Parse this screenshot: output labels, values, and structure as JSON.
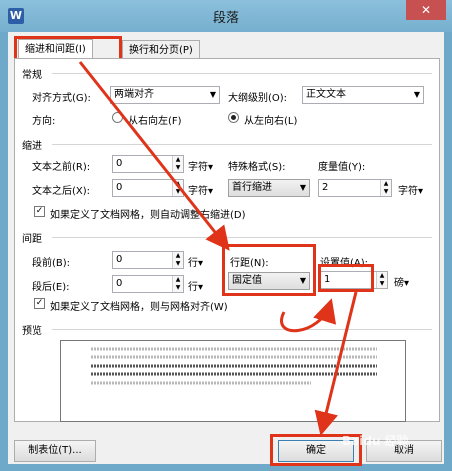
{
  "window": {
    "app_icon": "W",
    "title": "段落",
    "close": "✕"
  },
  "tabs": [
    {
      "label": "缩进和间距(I)"
    },
    {
      "label": "换行和分页(P)"
    }
  ],
  "general": {
    "section": "常规",
    "align_label": "对齐方式(G):",
    "align_value": "两端对齐",
    "outline_label": "大纲级别(O):",
    "outline_value": "正文文本",
    "direction_label": "方向:",
    "rtl": "从右向左(F)",
    "ltr": "从左向右(L)"
  },
  "indent": {
    "section": "缩进",
    "before_label": "文本之前(R):",
    "before_value": "0",
    "before_unit": "字符▾",
    "after_label": "文本之后(X):",
    "after_value": "0",
    "after_unit": "字符▾",
    "special_label": "特殊格式(S):",
    "special_value": "首行缩进",
    "measure_label": "度量值(Y):",
    "measure_value": "2",
    "measure_unit": "字符▾",
    "grid_check": "如果定义了文档网格，则自动调整右缩进(D)"
  },
  "spacing": {
    "section": "间距",
    "before_label": "段前(B):",
    "before_value": "0",
    "before_unit": "行▾",
    "after_label": "段后(E):",
    "after_value": "0",
    "after_unit": "行▾",
    "line_label": "行距(N):",
    "line_value": "固定值",
    "set_label": "设置值(A):",
    "set_value": "1",
    "set_unit": "磅▾",
    "grid_check": "如果定义了文档网格，则与网格对齐(W)"
  },
  "preview": {
    "section": "预览"
  },
  "buttons": {
    "tabs": "制表位(T)...",
    "ok": "确定",
    "cancel": "取消"
  },
  "watermark": "Baidu 经验"
}
